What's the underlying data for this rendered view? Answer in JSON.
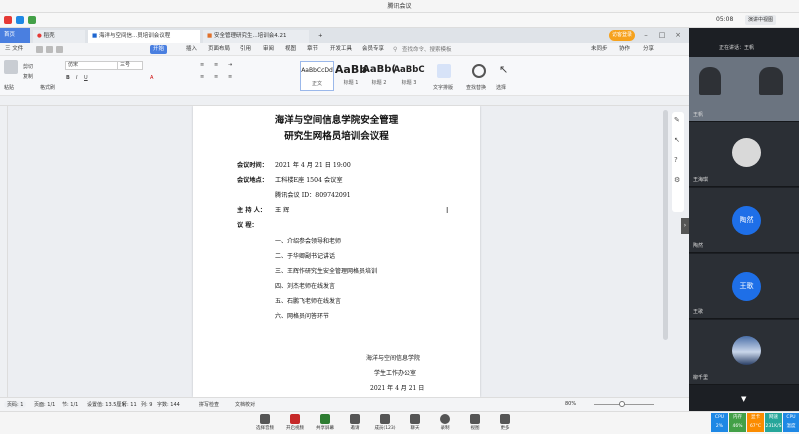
{
  "meeting": {
    "title": "腾讯会议",
    "time": "05:08",
    "speaking_badge": "演讲中视图",
    "current_speaker": "正在讲话：王帆",
    "toolbar": [
      {
        "label": "选择音频"
      },
      {
        "label": "开启视频"
      },
      {
        "label": "共享屏幕"
      },
      {
        "label": "邀请"
      },
      {
        "label": "成员(123)"
      },
      {
        "label": "聊天"
      },
      {
        "label": "录制"
      },
      {
        "label": "视图"
      },
      {
        "label": "更多"
      }
    ],
    "stats": [
      {
        "label": "CPU",
        "value": "2%",
        "color": "#1e88e5"
      },
      {
        "label": "内存",
        "value": "46%",
        "color": "#43a047"
      },
      {
        "label": "显卡",
        "value": "67°C",
        "color": "#fb8c00"
      },
      {
        "label": "网速",
        "value": "231K/S",
        "color": "#26a69a"
      },
      {
        "label": "CPU",
        "value": "温度",
        "color": "#1e88e5"
      }
    ],
    "participants": [
      {
        "name": "王帆",
        "type": "video"
      },
      {
        "name": "王海琪",
        "type": "avatar-photo"
      },
      {
        "name": "陶然",
        "type": "initials",
        "initials": "陶然"
      },
      {
        "name": "王歌",
        "type": "initials",
        "initials": "王歌"
      },
      {
        "name": "柳千里",
        "type": "landscape"
      }
    ]
  },
  "wps": {
    "tabs": [
      {
        "label": "首页"
      },
      {
        "label": "稻壳"
      },
      {
        "label": "海洋与空间信...员培训会议程"
      },
      {
        "label": "安全管理研究生...培训会4.21"
      }
    ],
    "login_label": "访客登录",
    "menu": {
      "file": "三 文件",
      "items": [
        "开始",
        "插入",
        "页面布局",
        "引用",
        "审阅",
        "视图",
        "章节",
        "开发工具",
        "会员专享"
      ],
      "search_placeholder": "查找命令、搜索模板",
      "right": [
        "未同步",
        "协作",
        "分享"
      ]
    },
    "ribbon": {
      "paste": "粘贴",
      "cut": "剪切",
      "copy": "复制",
      "format_painter": "格式刷",
      "font_name": "仿宋",
      "font_size": "三号",
      "styles": [
        {
          "sample": "AaBbCcDd",
          "name": "正文"
        },
        {
          "sample": "AaBb",
          "name": "标题 1"
        },
        {
          "sample": "AaBb(",
          "name": "标题 2"
        },
        {
          "sample": "AaBbC",
          "name": "标题 3"
        }
      ],
      "text_layout": "文字排版",
      "find_replace": "查找替换",
      "select": "选择"
    },
    "document": {
      "title1": "海洋与空间信息学院安全管理",
      "title2": "研究生网格员培训会议程",
      "time_label": "会议时间：",
      "time_value": "2021 年 4 月 21 日 19:00",
      "place_label": "会议地点：",
      "place_value": "工科楼E座 1504 会议室",
      "tencent_value": "腾讯会议 ID：809742091",
      "host_label": "主 持 人：",
      "host_value": "王  辉",
      "agenda_label": "议    程：",
      "agenda": [
        "一、介绍参会领导和老师",
        "二、于华卿副书记讲话",
        "三、王辉作研究生安全管理网格员培训",
        "四、刘杰老师在线发言",
        "五、石鹏飞老师在线发言",
        "六、网格员问答环节"
      ],
      "sign1": "海洋与空间信息学院",
      "sign2": "学生工作办公室",
      "sign3": "2021 年 4 月 21 日"
    },
    "status": {
      "page": "页码: 1",
      "pages": "页面: 1/1",
      "section": "节: 1/1",
      "setting": "设置值: 13.5厘米",
      "row": "行: 11",
      "col": "列: 9",
      "words": "字数: 144",
      "spell": "拼写检查",
      "proof": "文档校对",
      "zoom": "80%"
    }
  }
}
